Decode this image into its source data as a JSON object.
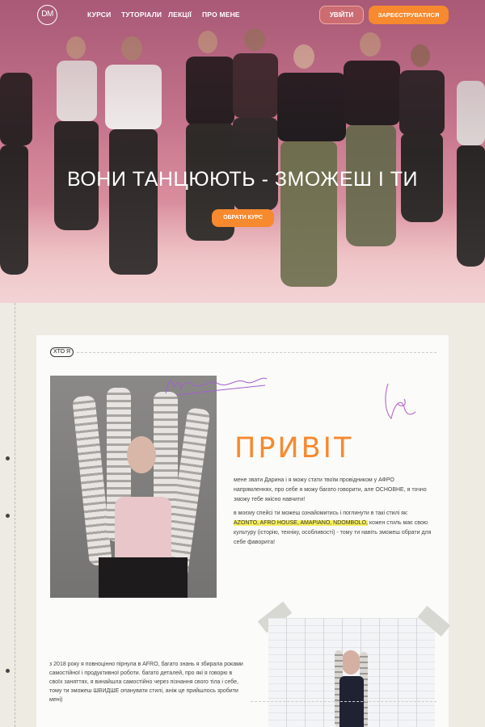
{
  "nav": {
    "logo": "DM",
    "links": [
      "КУРСИ",
      "ТУТОРІАЛИ",
      "ЛЕКЦІЇ",
      "ПРО МЕНЕ"
    ],
    "login": "УВІЙТИ",
    "register": "ЗАРЕЄСТРУВАТИСЯ"
  },
  "hero": {
    "title": "ВОНИ ТАНЦЮЮТЬ - ЗМОЖЕШ І ТИ",
    "cta": "ОБРАТИ КУРС"
  },
  "about": {
    "tag": "ХТО Я",
    "signature": "M Дарина",
    "heading": "ПРИВІТ",
    "intro": "мене звати Дарина і я можу стати твоїм провідником у АФРО напрямленнях, про себе я можу багато говорити, але ОСНОВНЕ, я точно зможу тебе якісно навчити!",
    "styles_prefix": "в моєму спейсі ти можеш ознайомитись і поглинути в такі стилі як:",
    "styles_highlight": "AZONTO, AFRO HOUSE, AMAPIANO, NDOMBOLO,",
    "styles_suffix": "кожен стиль має свою культуру (історію, техніку, особливості) - тому ти навіть зможеш обрати для себе фаворита!",
    "story": "з 2018 року я повноцінно пірнула в AFRO, багато знань я збирала роками самостійної і продуктивної роботи. багато деталей, про які я говорю в своїх заняттях, я винайшла самостійно через пізнання свого тіла і себе, тому ти зможеш ШВИДШЕ опанувати стилі, аніж це прийшлось зробити мені)"
  },
  "colors": {
    "accent": "#f7892e",
    "highlight": "#f7ef5e",
    "background": "#eeebe3"
  }
}
